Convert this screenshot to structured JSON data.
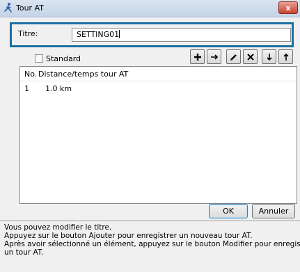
{
  "window": {
    "title": "Tour AT",
    "close_glyph": "x"
  },
  "form": {
    "title_label": "Titre:",
    "title_value": "SETTING01"
  },
  "standard": {
    "label": "Standard",
    "checked": false
  },
  "toolbar": {
    "add_icon": "plus-icon",
    "insert_icon": "arrow-right-icon",
    "edit_icon": "pencil-icon",
    "delete_icon": "x-icon",
    "move_down_icon": "arrow-down-icon",
    "move_up_icon": "arrow-up-icon"
  },
  "list": {
    "columns": [
      "No.",
      "Distance/temps tour AT"
    ],
    "rows": [
      {
        "no": "1",
        "value": "1.0 km"
      }
    ]
  },
  "buttons": {
    "ok": "OK",
    "cancel": "Annuler"
  },
  "help": {
    "lines": [
      "Vous pouvez modifier le titre.",
      "Appuyez sur le bouton Ajouter pour enregistrer un nouveau tour AT.",
      "Après avoir sélectionné un élément, appuyez sur le bouton Modifier pour enregistrer",
      "un tour AT."
    ]
  }
}
